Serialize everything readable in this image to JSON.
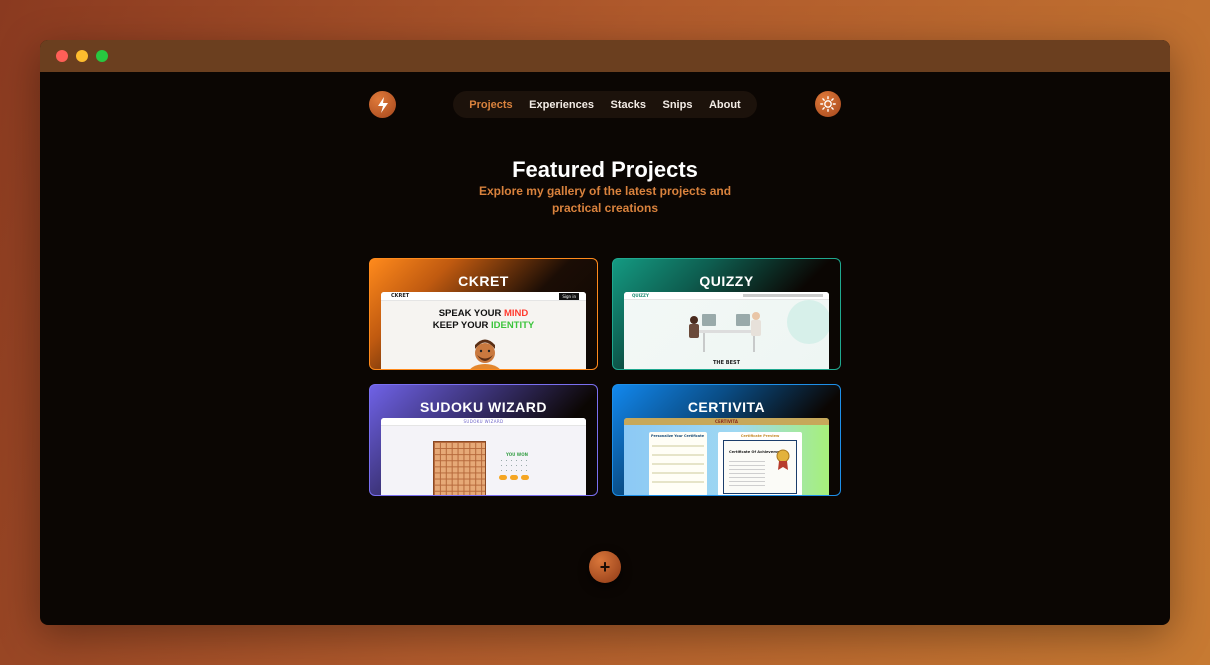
{
  "window": {
    "controls": [
      "close",
      "minimize",
      "maximize"
    ]
  },
  "header": {
    "logo_icon": "bolt-logo-icon",
    "theme_icon": "sun-icon",
    "nav": [
      {
        "label": "Projects",
        "active": true
      },
      {
        "label": "Experiences"
      },
      {
        "label": "Stacks"
      },
      {
        "label": "Snips"
      },
      {
        "label": "About"
      }
    ]
  },
  "main": {
    "title": "Featured Projects",
    "subtitle_line1": "Explore my gallery of the latest projects and",
    "subtitle_line2": "practical creations",
    "projects": [
      {
        "name": "CKRET",
        "preview": {
          "brand": "CKRET",
          "button": "Sign in",
          "line1a": "SPEAK YOUR ",
          "line1b": "MIND",
          "line2a": "KEEP YOUR ",
          "line2b": "IDENTITY"
        }
      },
      {
        "name": "QUIZZY",
        "preview": {
          "brand": "QUIZZY",
          "caption": "THE BEST"
        }
      },
      {
        "name": "SUDOKU WIZARD",
        "preview": {
          "title": "SUDOKU WIZARD",
          "status": "YOU WON"
        }
      },
      {
        "name": "CERTIVITA",
        "preview": {
          "brand": "CERTIVITA",
          "form_title": "Personalize Your Certificate",
          "preview_title": "Certificate Preview",
          "cert_heading": "Certificate Of Achievement"
        }
      }
    ],
    "add_button": "+"
  },
  "colors": {
    "accent": "#d9823d",
    "background": "#0b0603",
    "ckret_border": "#ff8a1c",
    "quizzy_border": "#1fa88f",
    "sudoku_border": "#7a6ff0",
    "certivita_border": "#1e8fe8"
  }
}
